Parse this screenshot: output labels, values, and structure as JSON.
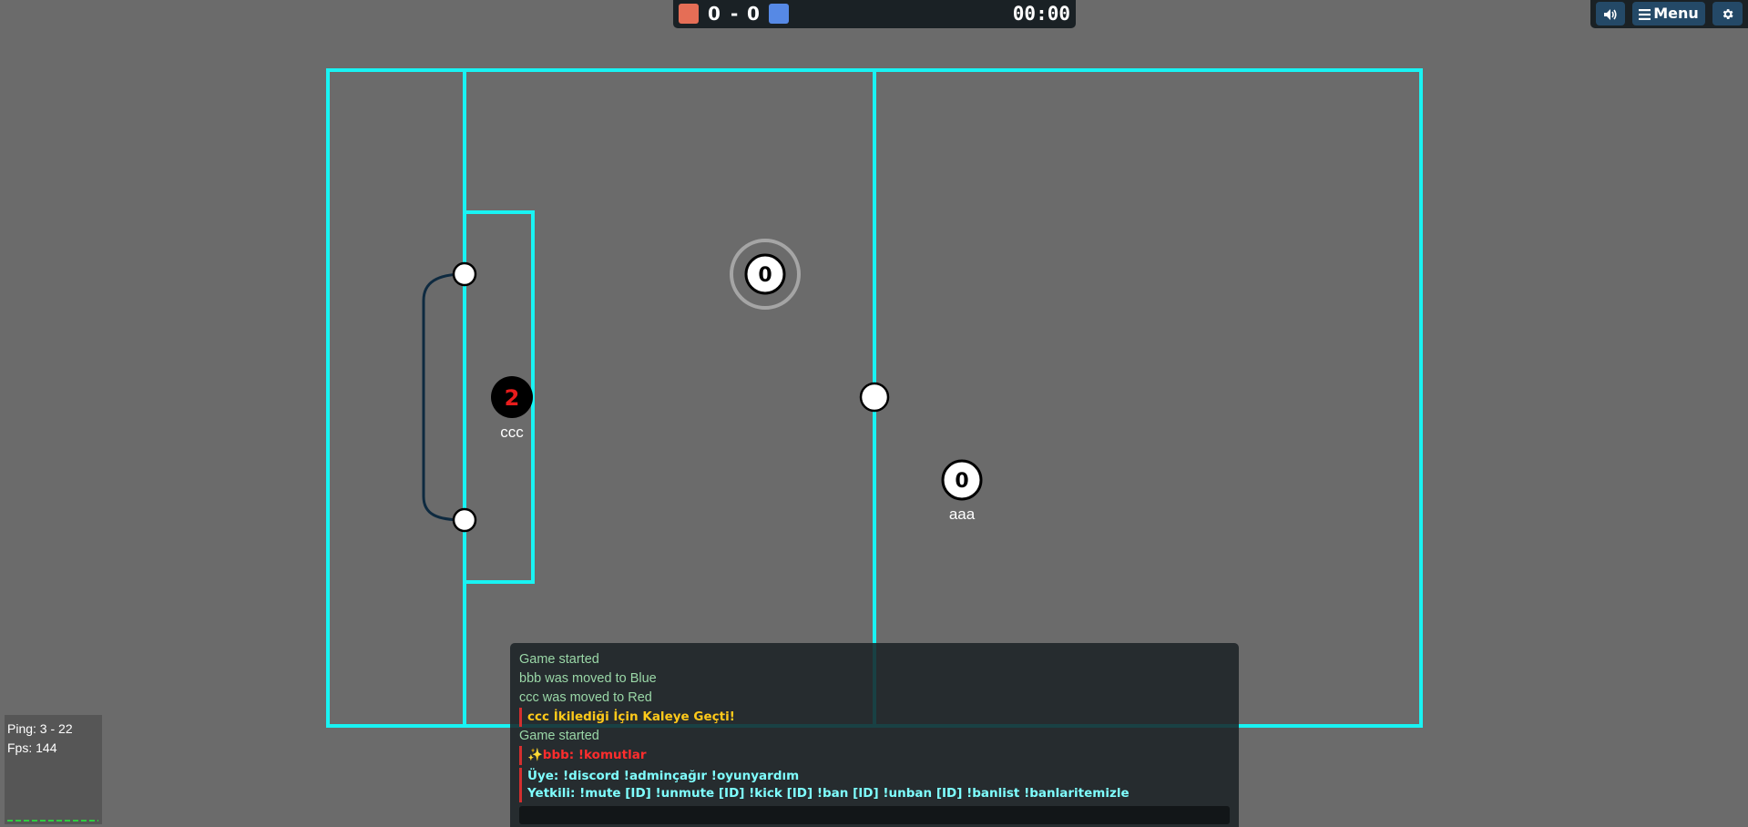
{
  "scoreboard": {
    "red_score": "0",
    "separator": "-",
    "blue_score": "0",
    "timer": "00:00",
    "red_color": "#e56e56",
    "blue_color": "#5689e5"
  },
  "top_buttons": {
    "sound_icon": "speaker-icon",
    "menu_label": "Menu",
    "menu_icon": "hamburger-icon",
    "settings_icon": "gear-icon"
  },
  "field": {
    "line_color": "#19f3f3",
    "goal_net_color": "#0e2a40",
    "background": "#6b6b6b"
  },
  "players": [
    {
      "name": "ccc",
      "number": "2",
      "team": "red"
    },
    {
      "name": "aaa",
      "number": "0",
      "team": "spectator"
    }
  ],
  "ball": {
    "number": "0"
  },
  "stats": {
    "ping": "Ping: 3 - 22",
    "fps": "Fps: 144"
  },
  "chat": {
    "messages": [
      {
        "type": "system",
        "text": "Game started"
      },
      {
        "type": "system",
        "text": "bbb was moved to Blue"
      },
      {
        "type": "system",
        "text": "ccc was moved to Red"
      },
      {
        "type": "announcement",
        "text": "ccc İkilediği İçin Kaleye Geçti!"
      },
      {
        "type": "system",
        "text": "Game started"
      },
      {
        "type": "announcement",
        "text": "✨bbb: !komutlar"
      },
      {
        "type": "announcement",
        "text": "Üye: !discord !adminçağır !oyunyardım"
      },
      {
        "type": "announcement",
        "text": "Yetkili: !mute [ID] !unmute [ID] !kick [ID] !ban [ID] !unban [ID] !banlist !banlaritemizle"
      }
    ],
    "input_value": ""
  }
}
